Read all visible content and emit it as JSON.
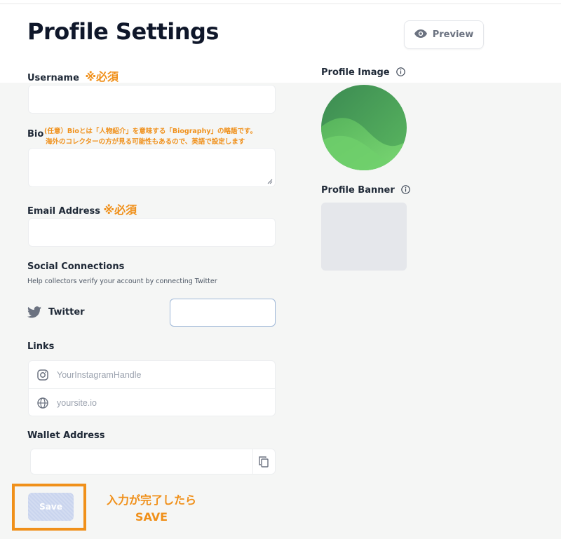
{
  "page": {
    "title": "Profile Settings",
    "preview_label": "Preview"
  },
  "form": {
    "username_label": "Username",
    "username_required": "※必須",
    "bio_label": "Bio",
    "bio_note_line1": "(任意）Bioとは「人物紹介」を意味する「Biography」の略語です。",
    "bio_note_line2": "海外のコレクターの方が見る可能性もあるので、英語で設定します",
    "email_label": "Email Address",
    "email_required": "※必須",
    "social_title": "Social Connections",
    "social_sub": "Help collectors verify your account by connecting Twitter",
    "twitter_label": "Twitter",
    "links_title": "Links",
    "instagram_placeholder": "YourInstagramHandle",
    "website_placeholder": "yoursite.io",
    "wallet_label": "Wallet Address",
    "save_label": "Save",
    "save_note_line1": "入力が完了したら",
    "save_note_line2": "SAVE"
  },
  "side": {
    "profile_image_label": "Profile Image",
    "profile_banner_label": "Profile Banner"
  },
  "colors": {
    "accent_orange": "#f0901a",
    "save_button": "#c9d4ee",
    "avatar_green_dark": "#3f9a58",
    "avatar_green_light": "#6ccf6a",
    "banner_gray": "#e5e7eb"
  },
  "icons": [
    "eye-icon",
    "info-icon",
    "twitter-icon",
    "instagram-icon",
    "globe-icon",
    "copy-icon"
  ]
}
